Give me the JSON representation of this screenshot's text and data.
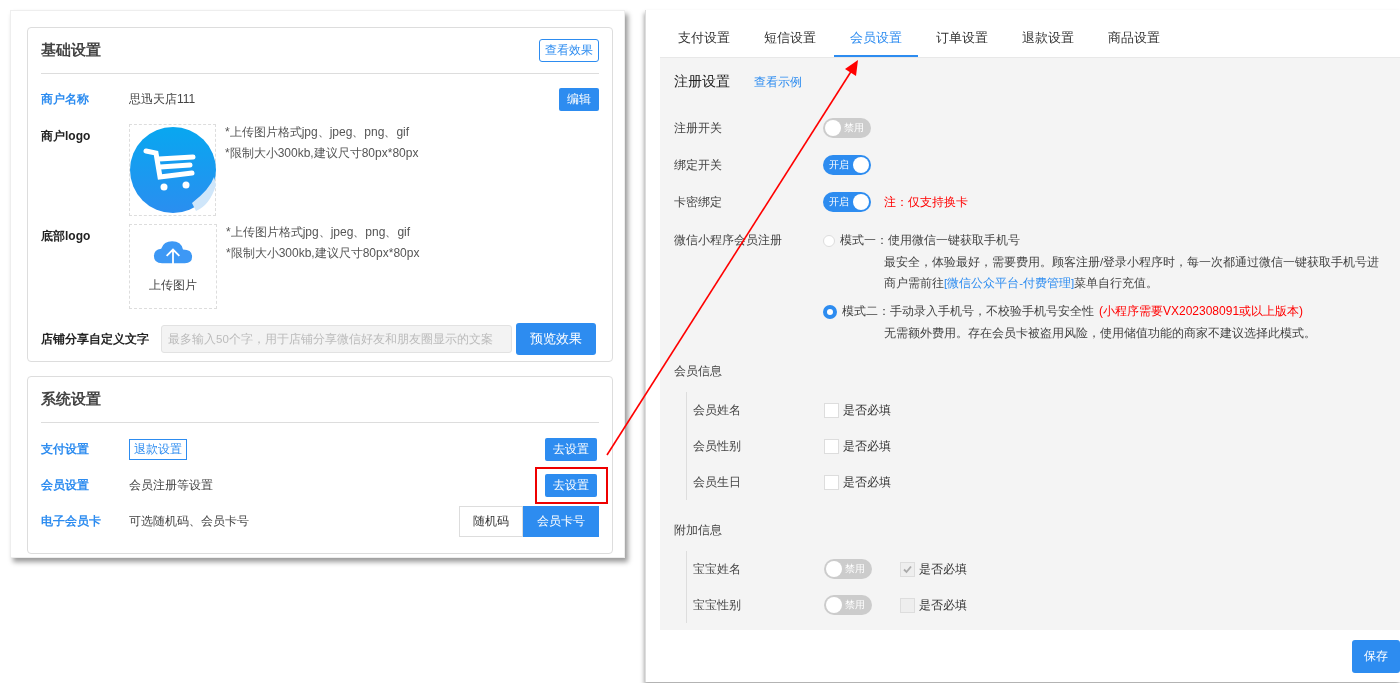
{
  "basic_settings": {
    "title": "基础设置",
    "view_button": "查看效果",
    "merchant_name": {
      "label": "商户名称",
      "value": "思迅天店111",
      "button": "编辑"
    },
    "merchant_logo": {
      "label": "商户logo",
      "notes": [
        "*上传图片格式jpg、jpeg、png、gif",
        "*限制大小300kb,建议尺寸80px*80px"
      ]
    },
    "footer_logo": {
      "label": "底部logo",
      "upload_text": "上传图片",
      "notes": [
        "*上传图片格式jpg、jpeg、png、gif",
        "*限制大小300kb,建议尺寸80px*80px"
      ]
    },
    "share_text": {
      "label": "店铺分享自定义文字",
      "placeholder": "最多输入50个字，用于店铺分享微信好友和朋友圈显示的文案",
      "button": "预览效果"
    }
  },
  "system_settings": {
    "title": "系统设置",
    "rows": [
      {
        "kind": "tag",
        "label": "支付设置",
        "tag": "退款设置",
        "button": "去设置",
        "highlighted": false
      },
      {
        "kind": "text",
        "label": "会员设置",
        "text": "会员注册等设置",
        "button": "去设置",
        "highlighted": true
      },
      {
        "kind": "choice",
        "label": "电子会员卡",
        "text": "可选随机码、会员卡号",
        "options": [
          {
            "label": "随机码",
            "selected": false
          },
          {
            "label": "会员卡号",
            "selected": true
          }
        ]
      }
    ]
  },
  "member_page": {
    "tabs": [
      {
        "label": "支付设置",
        "selected": false
      },
      {
        "label": "短信设置",
        "selected": false
      },
      {
        "label": "会员设置",
        "selected": true
      },
      {
        "label": "订单设置",
        "selected": false
      },
      {
        "label": "退款设置",
        "selected": false
      },
      {
        "label": "商品设置",
        "selected": false
      }
    ],
    "section": {
      "title": "注册设置",
      "link": "查看示例"
    },
    "switches": [
      {
        "label": "注册开关",
        "on": false,
        "text": "禁用"
      },
      {
        "label": "绑定开关",
        "on": true,
        "text": "开启"
      },
      {
        "label": "卡密绑定",
        "on": true,
        "text": "开启",
        "note": "注：仅支持换卡"
      }
    ],
    "wechat_registration": {
      "label": "微信小程序会员注册",
      "options": [
        {
          "label": "模式一：使用微信一键获取手机号",
          "selected": false,
          "description": [
            {
              "text": "最安全，体验最好，需要费用。顾客注册/登录小程序时，每一次都通过微信一键获取手机号进"
            },
            {
              "text": "商户需前往",
              "link": "[微信公众平台-付费管理]",
              "after": "菜单自行充值。"
            }
          ]
        },
        {
          "label": "模式二：手动录入手机号，不校验手机号安全性",
          "warning": "(小程序需要VX202308091或以上版本)",
          "selected": true,
          "description": [
            {
              "text": "无需额外费用。存在会员卡被盗用风险，使用储值功能的商家不建议选择此模式。"
            }
          ]
        }
      ]
    },
    "member_info": {
      "title": "会员信息",
      "fields": [
        {
          "label": "会员姓名",
          "required_label": "是否必填",
          "checked": false
        },
        {
          "label": "会员性别",
          "required_label": "是否必填",
          "checked": false
        },
        {
          "label": "会员生日",
          "required_label": "是否必填",
          "checked": false
        }
      ]
    },
    "extra_info": {
      "title": "附加信息",
      "fields": [
        {
          "label": "宝宝姓名",
          "switch_text": "禁用",
          "on": false,
          "required_label": "是否必填",
          "checked": true,
          "disabled": true
        },
        {
          "label": "宝宝性别",
          "switch_text": "禁用",
          "on": false,
          "required_label": "是否必填",
          "checked": false,
          "disabled": true
        }
      ]
    },
    "save_button": "保存"
  }
}
